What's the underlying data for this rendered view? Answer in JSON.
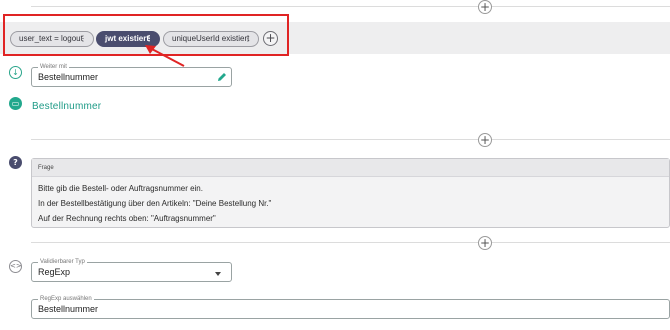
{
  "conditions": [
    {
      "label": "user_text = logout",
      "selected": false
    },
    {
      "label": "jwt existiert",
      "selected": true
    },
    {
      "label": "uniqueUserId existiert",
      "selected": false
    }
  ],
  "weiter_mit": {
    "label": "Weiter mit",
    "value": "Bestellnummer"
  },
  "step_title": "Bestellnummer",
  "frage": {
    "header": "Frage",
    "lines": [
      "Bitte gib die Bestell- oder Auftragsnummer ein.",
      "In der Bestellbestätigung über den Artikeln: \"Deine Bestellung Nr.\"",
      "Auf der Rechnung rechts oben: \"Auftragsnummer\""
    ]
  },
  "validator_type": {
    "label": "Validierbarer Typ",
    "value": "RegExp"
  },
  "regexp_select": {
    "label": "RegExp auswählen",
    "value": "Bestellnummer"
  },
  "icons": {
    "add": "plus-circle-icon",
    "menu": "more-vertical-icon",
    "edit": "pencil-icon",
    "arrow": "arrow-down-circle-icon",
    "message": "message-bubble-icon",
    "help": "question-circle-icon",
    "code": "code-brackets-icon"
  },
  "colors": {
    "accent_teal": "#22a88d",
    "chip_dark": "#4a4d6e",
    "highlight_red": "#e02424"
  }
}
